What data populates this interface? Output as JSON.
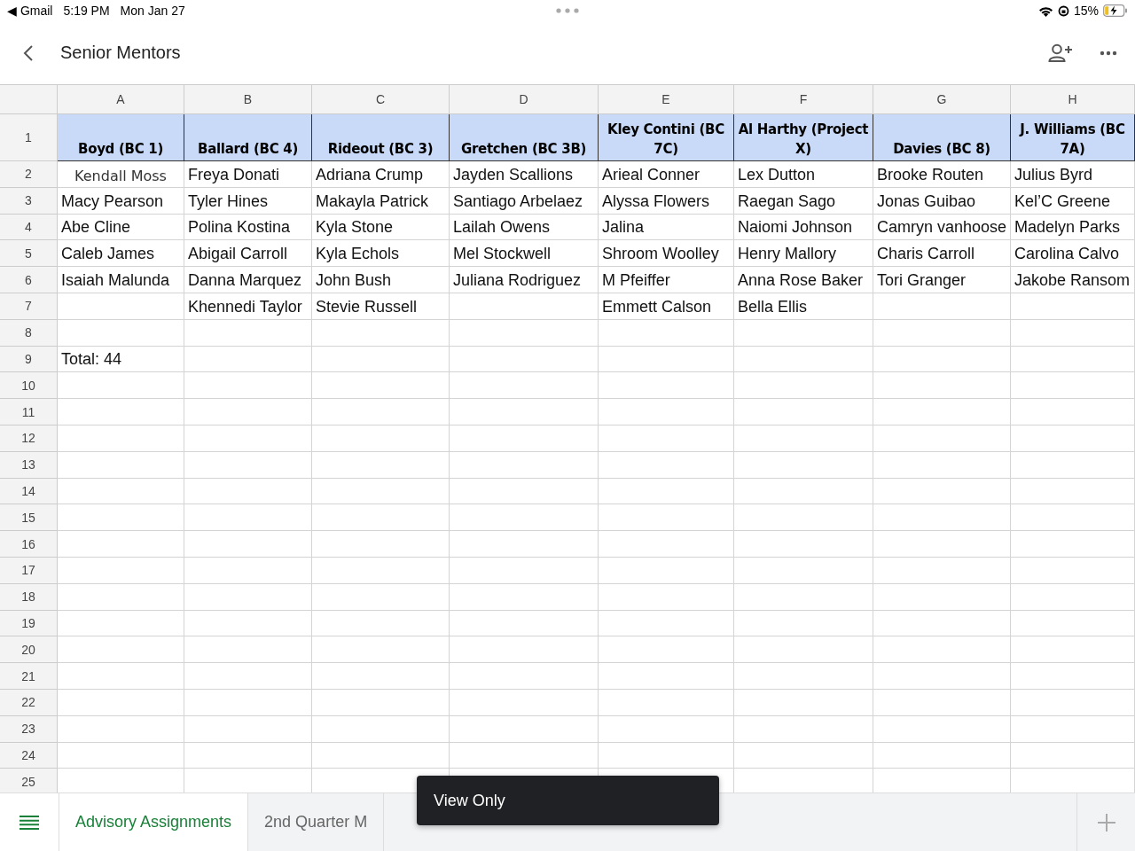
{
  "status_bar": {
    "back_app": "◀ Gmail",
    "time": "5:19 PM",
    "date": "Mon Jan 27",
    "battery": "15%"
  },
  "title_bar": {
    "title": "Senior Mentors"
  },
  "sheet": {
    "columns": [
      "A",
      "B",
      "C",
      "D",
      "E",
      "F",
      "G",
      "H"
    ],
    "header_row": {
      "number": "1",
      "cells": [
        "Boyd (BC 1)",
        "Ballard (BC 4)",
        "Rideout (BC 3)",
        "Gretchen (BC 3B)",
        "Kley Contini (BC 7C)",
        "Al Harthy (Project X)",
        "Davies (BC 8)",
        "J. Williams (BC 7A)"
      ]
    },
    "rows": [
      {
        "number": "2",
        "cells": {
          "A": {
            "text": "Kendall Moss",
            "kind": "centered"
          },
          "B": "Freya Donati",
          "C": "Adriana Crump",
          "D": "Jayden Scallions",
          "E": "Arieal Conner",
          "F": "Lex Dutton",
          "G": "Brooke Routen",
          "H": "Julius Byrd"
        }
      },
      {
        "number": "3",
        "cells": {
          "A": "Macy Pearson",
          "B": "Tyler Hines",
          "C": "Makayla Patrick",
          "D": "Santiago Arbelaez",
          "E": "Alyssa Flowers",
          "F": "Raegan Sago",
          "G": "Jonas Guibao",
          "H": "Kel’C Greene"
        }
      },
      {
        "number": "4",
        "cells": {
          "A": "Abe Cline",
          "B": "Polina Kostina",
          "C": "Kyla Stone",
          "D": "Lailah Owens",
          "E": "Jalina",
          "F": "Naiomi Johnson",
          "G": "Camryn vanhoose",
          "H": "Madelyn Parks"
        }
      },
      {
        "number": "5",
        "cells": {
          "A": "Caleb James",
          "B": "Abigail Carroll",
          "C": "Kyla Echols",
          "D": "Mel Stockwell",
          "E": "Shroom Woolley",
          "F": "Henry Mallory",
          "G": "Charis Carroll",
          "H": "Carolina Calvo"
        }
      },
      {
        "number": "6",
        "cells": {
          "A": "Isaiah Malunda",
          "B": "Danna Marquez",
          "C": "John Bush",
          "D": "Juliana Rodriguez",
          "E": "M Pfeiffer",
          "F": "Anna Rose Baker",
          "G": "Tori Granger",
          "H": "Jakobe Ransom"
        }
      },
      {
        "number": "7",
        "cells": {
          "B": "Khennedi Taylor",
          "C": "Stevie Russell",
          "E": "Emmett Calson",
          "F": "Bella Ellis"
        }
      },
      {
        "number": "8",
        "cells": {}
      },
      {
        "number": "9",
        "cells": {
          "A": "Total: 44"
        }
      },
      {
        "number": "10",
        "cells": {}
      },
      {
        "number": "11",
        "cells": {}
      },
      {
        "number": "12",
        "cells": {}
      },
      {
        "number": "13",
        "cells": {}
      },
      {
        "number": "14",
        "cells": {}
      },
      {
        "number": "15",
        "cells": {}
      },
      {
        "number": "16",
        "cells": {}
      },
      {
        "number": "17",
        "cells": {}
      },
      {
        "number": "18",
        "cells": {}
      },
      {
        "number": "19",
        "cells": {}
      },
      {
        "number": "20",
        "cells": {}
      },
      {
        "number": "21",
        "cells": {}
      },
      {
        "number": "22",
        "cells": {}
      },
      {
        "number": "23",
        "cells": {}
      },
      {
        "number": "24",
        "cells": {}
      },
      {
        "number": "25",
        "cells": {}
      }
    ]
  },
  "sheet_tabs": [
    {
      "label": "Advisory Assignments",
      "selected": true
    },
    {
      "label": "2nd Quarter M",
      "selected": false
    }
  ],
  "toast": {
    "text": "View Only"
  }
}
